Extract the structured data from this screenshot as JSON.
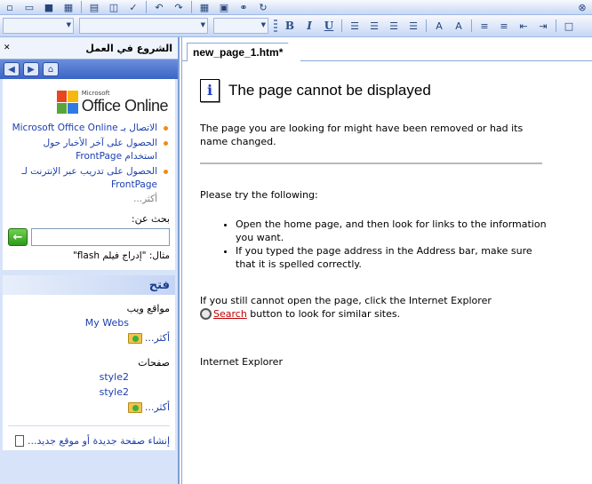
{
  "toolbar": {
    "standard_icons": [
      "new-icon",
      "open-icon",
      "save-icon",
      "publish-icon",
      "print-icon",
      "preview-icon",
      "spelling-icon",
      "undo-icon",
      "redo-icon",
      "table-icon",
      "picture-icon",
      "hyperlink-icon",
      "refresh-icon",
      "close-icon"
    ],
    "bold_label": "B",
    "italic_label": "I",
    "underline_label": "U"
  },
  "task_pane": {
    "title": "الشروع في العمل",
    "logo": {
      "maker": "Microsoft",
      "name": "Office Online"
    },
    "online_links": [
      "الاتصال بـ Microsoft Office Online",
      "الحصول على آخر الأخبار حول استخدام FrontPage",
      "الحصول على تدريب عبر الإنترنت لـ FrontPage"
    ],
    "more_label": "أكثر...",
    "search_label": "بحث عن:",
    "search_value": "",
    "search_example": "مثال: \"إدراج فيلم flash\"",
    "open_title": "فتح",
    "websites_label": "مواقع ويب",
    "websites": [
      "My Webs"
    ],
    "websites_more": "أكثر...",
    "pages_label": "صفحات",
    "pages": [
      "style2",
      "style2"
    ],
    "pages_more": "أكثر...",
    "new_page_label": "إنشاء صفحة جديدة أو موقع جديد..."
  },
  "document": {
    "tab_label": "new_page_1.htm*",
    "error_title": "The page cannot be displayed",
    "error_desc": "The page you are looking for might have been removed or had its name changed.",
    "try_label": "Please try the following:",
    "steps": [
      "Open the home page, and then look for links to the information you want.",
      "If you typed the page address in the Address bar, make sure that it is spelled correctly."
    ],
    "ie_msg_before": "If you still cannot open the page, click the Internet Explorer",
    "search_link": "Search",
    "ie_msg_after": " button to look for similar sites.",
    "signature": "Internet Explorer"
  },
  "colors": {
    "link": "#1c3fae",
    "search_link": "#c00000",
    "bullet": "#f08a1a"
  }
}
